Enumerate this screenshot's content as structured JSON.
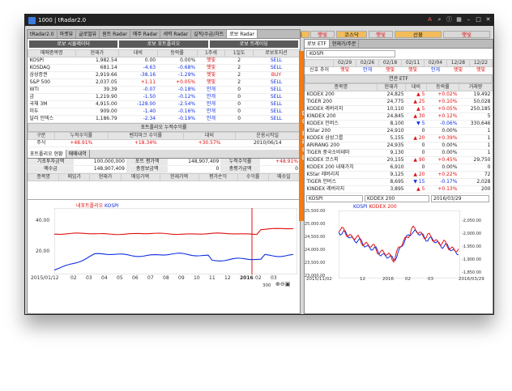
{
  "window": {
    "title": "1000 | tRadar2.0"
  },
  "top_pills": [
    {
      "label": "코스피",
      "bg": "#f2bc5a"
    },
    {
      "label": "햇빛",
      "bg": "#fff"
    },
    {
      "label": "코스닥",
      "bg": "#f2bc5a"
    },
    {
      "label": "햇빛",
      "bg": "#fff"
    },
    {
      "label": "선물",
      "bg": "#f2bc5a"
    },
    {
      "label": "햇빛",
      "bg": "#fff"
    }
  ],
  "left": {
    "tabs": [
      "tRadar2.0",
      "마켓뷰",
      "글로벌뷰",
      "원트 Radar",
      "매주 Radar",
      "세력 Radar",
      "실적/수급/차트",
      "로보 Radar"
    ],
    "sub_buttons": [
      "로보 시뮬레이터",
      "로보 포트폴리오",
      "로보 트레이딩"
    ],
    "table_headers": [
      "매매종목명",
      "현재가",
      "대비",
      "등락률",
      "1주세",
      "1일도",
      "로보포지션"
    ],
    "rows": [
      [
        "KOSPI",
        "1,982.54",
        "0.00",
        "0.00%",
        "햇빛",
        "2",
        "SELL"
      ],
      [
        "KOSDAQ",
        "681.14",
        "-4.63",
        "-0.68%",
        "햇빛",
        "2",
        "SELL"
      ],
      [
        "삼성증권",
        "2,919.66",
        "-38.16",
        "-1.29%",
        "햇빛",
        "2",
        "BUY"
      ],
      [
        "S&P 500",
        "2,037.05",
        "+1.11",
        "+0.05%",
        "햇빛",
        "2",
        "SELL"
      ],
      [
        "WTI",
        "39.39",
        "-0.07",
        "-0.18%",
        "안개",
        "0",
        "SELL"
      ],
      [
        "금",
        "1,219.90",
        "-1.50",
        "-0.12%",
        "안개",
        "0",
        "SELL"
      ],
      [
        "국채 3M",
        "4,915.00",
        "-128.00",
        "-2.54%",
        "안개",
        "0",
        "SELL"
      ],
      [
        "미두",
        "909.00",
        "-1.40",
        "-0.16%",
        "안개",
        "0",
        "SELL"
      ],
      [
        "달러 인덱스",
        "1,186.79",
        "-2.34",
        "-0.19%",
        "안개",
        "0",
        "SELL"
      ]
    ],
    "perf_title": "포트폴리오 누적수익률",
    "perf_headers": [
      "구분",
      "누적수익률",
      "벤치마크 수익률",
      "대비",
      "운용시작일"
    ],
    "perf_row": [
      "주식",
      "+48.91%",
      "+18.34%",
      "+30.57%",
      "2010/06/14"
    ],
    "sub_tabs": [
      "포트폴리오 현황",
      "매매내역"
    ],
    "stat_rows": [
      [
        "기초투자금액",
        "100,000,000",
        "포트 평가액",
        "148,907,409",
        "누적수익률",
        "+48.91%"
      ],
      [
        "예수금",
        "148,907,409",
        "총정보금액",
        "0",
        "총평가금액",
        "0"
      ]
    ],
    "trade_headers": [
      "종목명",
      "매입가",
      "현재가",
      "매입가액",
      "현재가액",
      "평가손익",
      "수익률",
      "매수일"
    ],
    "chart": {
      "legend": [
        "내포트폴리오",
        "KOSPI"
      ],
      "yticks": [
        "40.00",
        "20.00"
      ],
      "xticks": [
        "2015/01/12",
        "02",
        "03",
        "04",
        "05",
        "06",
        "07",
        "08",
        "09",
        "10",
        "11",
        "12",
        "2016",
        "02",
        "03"
      ],
      "zoom": "300"
    }
  },
  "right": {
    "tabs": [
      "로보 ETF",
      "현재가/주문"
    ],
    "index_name": "KOSPI",
    "date_headers": [
      "02/29",
      "02/26",
      "02/18",
      "02/11",
      "02/04",
      "12/28",
      "12/22"
    ],
    "signal_label": "신호 추이",
    "signals": [
      "햇빛",
      "안개",
      "햇빛",
      "햇빛",
      "안개",
      "햇빛",
      "햇빛"
    ],
    "etf_title": "연관 ETF",
    "etf_headers": [
      "종목명",
      "현재가",
      "대비",
      "등락률",
      "거래량"
    ],
    "etf_rows": [
      [
        "KODEX 200",
        "24,825",
        "▲ 5",
        "+0.02%",
        "19,492"
      ],
      [
        "TIGER 200",
        "24,775",
        "▲ 25",
        "+0.10%",
        "50,028"
      ],
      [
        "KODEX 레버리지",
        "10,110",
        "▲ 5",
        "+0.05%",
        "250,185"
      ],
      [
        "KINDEX 200",
        "24,845",
        "▲ 30",
        "+0.12%",
        "5"
      ],
      [
        "KODEX 인버스",
        "8,100",
        "▼ 5",
        "-0.06%",
        "330,646"
      ],
      [
        "KStar 200",
        "24,910",
        "0",
        "0.00%",
        "1"
      ],
      [
        "KODEX 삼성그룹",
        "5,155",
        "▲ 20",
        "+0.39%",
        "1"
      ],
      [
        "ARIRANG 200",
        "24,935",
        "0",
        "0.00%",
        "1"
      ],
      [
        "TIGER 중국소비테마",
        "9,130",
        "0",
        "0.00%",
        "1"
      ],
      [
        "KODEX 코스피",
        "20,155",
        "▲ 90",
        "+0.45%",
        "29,750"
      ],
      [
        "KODEX 200 내재가치",
        "6,910",
        "0",
        "0.00%",
        "0"
      ],
      [
        "KStar 레버리지",
        "9,125",
        "▲ 20",
        "+0.22%",
        "72"
      ],
      [
        "TIGER 인버스",
        "8,695",
        "▼ 15",
        "-0.17%",
        "2,028"
      ],
      [
        "KINDEX 레버리지",
        "3,895",
        "▲ 5",
        "+0.13%",
        "200"
      ]
    ],
    "chart_inputs": [
      "KOSPI",
      "KODEX 200",
      "2016/03/29"
    ],
    "chart": {
      "legend": [
        "KOSPI",
        "KODEX 200"
      ],
      "left_ticks": [
        "25,500.00",
        "25,000.00",
        "24,500.00",
        "24,000.00",
        "23,500.00",
        "23,000.00"
      ],
      "right_ticks": [
        "-2,050.00",
        "-2,000.00",
        "-1,950.00",
        "-1,900.00",
        "-1,850.00"
      ],
      "xticks": [
        "2015/11/02",
        "12",
        "2016",
        "02",
        "03",
        "2016/03/29"
      ],
      "zoom": "100"
    }
  },
  "band_text": "마이 티레이더"
}
